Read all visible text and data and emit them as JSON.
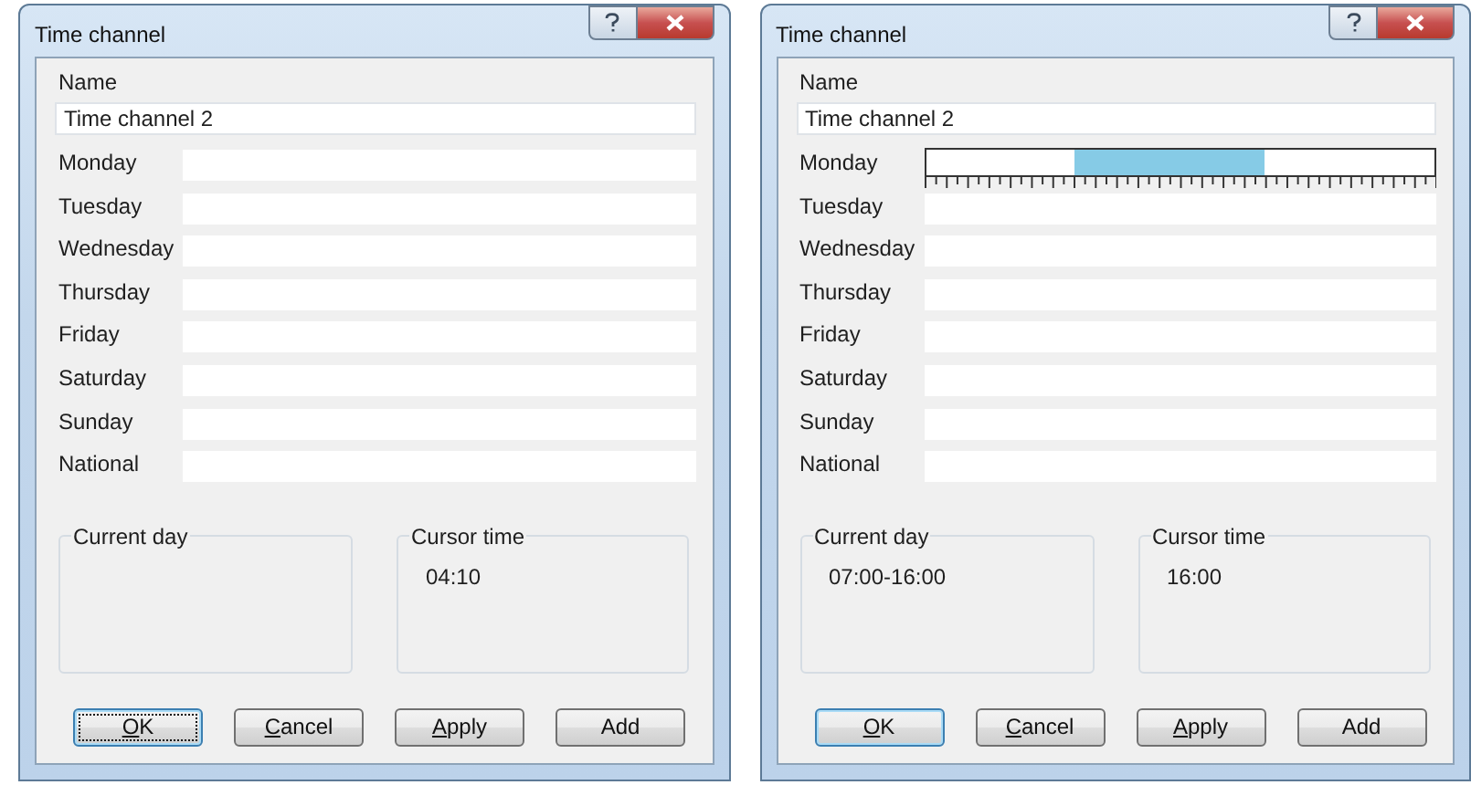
{
  "dialogs": [
    {
      "title": "Time channel",
      "name_label": "Name",
      "name_value": "Time channel 2",
      "days": [
        {
          "label": "Monday",
          "kind": "empty"
        },
        {
          "label": "Tuesday",
          "kind": "empty"
        },
        {
          "label": "Wednesday",
          "kind": "empty"
        },
        {
          "label": "Thursday",
          "kind": "empty"
        },
        {
          "label": "Friday",
          "kind": "empty"
        },
        {
          "label": "Saturday",
          "kind": "empty"
        },
        {
          "label": "Sunday",
          "kind": "empty"
        },
        {
          "label": "National",
          "kind": "empty"
        }
      ],
      "groups": [
        {
          "legend": "Current day"
        },
        {
          "legend": "Cursor time",
          "value": "04:10"
        }
      ],
      "buttons": [
        {
          "label": "OK",
          "underline_first": true,
          "default": true,
          "focused": true
        },
        {
          "label": "Cancel",
          "underline_first": true,
          "default": false,
          "focused": false
        },
        {
          "label": "Apply",
          "underline_first": true,
          "default": false,
          "focused": false
        },
        {
          "label": "Add",
          "underline_first": false,
          "default": false,
          "focused": false
        }
      ]
    },
    {
      "title": "Time channel",
      "name_label": "Name",
      "name_value": "Time channel 2",
      "days": [
        {
          "label": "Monday",
          "kind": "timeline",
          "hours": [
            {
              "selected": false
            },
            {
              "selected": false
            },
            {
              "selected": false
            },
            {
              "selected": false
            },
            {
              "selected": false
            },
            {
              "selected": false
            },
            {
              "selected": false
            },
            {
              "selected": true
            },
            {
              "selected": true
            },
            {
              "selected": true
            },
            {
              "selected": true
            },
            {
              "selected": true
            },
            {
              "selected": true
            },
            {
              "selected": true
            },
            {
              "selected": true
            },
            {
              "selected": true
            },
            {
              "selected": false
            },
            {
              "selected": false
            },
            {
              "selected": false
            },
            {
              "selected": false
            },
            {
              "selected": false
            },
            {
              "selected": false
            },
            {
              "selected": false
            },
            {
              "selected": false
            }
          ]
        },
        {
          "label": "Tuesday",
          "kind": "empty"
        },
        {
          "label": "Wednesday",
          "kind": "empty"
        },
        {
          "label": "Thursday",
          "kind": "empty"
        },
        {
          "label": "Friday",
          "kind": "empty"
        },
        {
          "label": "Saturday",
          "kind": "empty"
        },
        {
          "label": "Sunday",
          "kind": "empty"
        },
        {
          "label": "National",
          "kind": "empty"
        }
      ],
      "groups": [
        {
          "legend": "Current day",
          "value": "07:00-16:00"
        },
        {
          "legend": "Cursor time",
          "value": "16:00"
        }
      ],
      "buttons": [
        {
          "label": "OK",
          "underline_first": true,
          "default": true,
          "focused": false
        },
        {
          "label": "Cancel",
          "underline_first": true,
          "default": false,
          "focused": false
        },
        {
          "label": "Apply",
          "underline_first": true,
          "default": false,
          "focused": false
        },
        {
          "label": "Add",
          "underline_first": false,
          "default": false,
          "focused": false
        }
      ]
    }
  ]
}
